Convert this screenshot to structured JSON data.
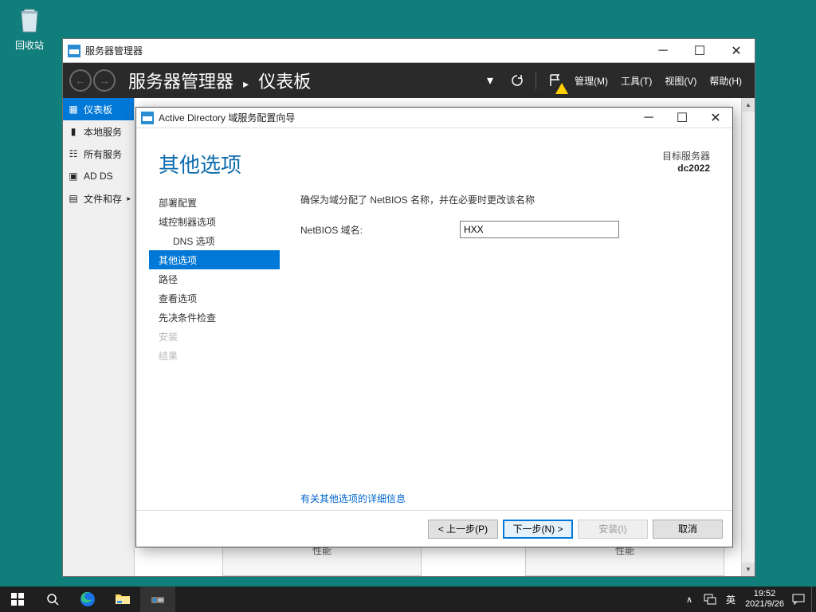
{
  "desktop": {
    "recycle_bin": "回收站"
  },
  "server_manager": {
    "title": "服务器管理器",
    "breadcrumb_root": "服务器管理器",
    "breadcrumb_page": "仪表板",
    "menus": {
      "manage": "管理(M)",
      "tools": "工具(T)",
      "view": "视图(V)",
      "help": "帮助(H)"
    },
    "sidebar": {
      "dashboard": "仪表板",
      "local_server": "本地服务",
      "all_servers": "所有服务",
      "ad_ds": "AD DS",
      "file_storage": "文件和存"
    },
    "tile_perf": "性能"
  },
  "wizard": {
    "window_title": "Active Directory 域服务配置向导",
    "heading": "其他选项",
    "target_label": "目标服务器",
    "target_server": "dc2022",
    "nav": {
      "deployment": "部署配置",
      "dc_options": "域控制器选项",
      "dns_options": "DNS 选项",
      "additional": "其他选项",
      "paths": "路径",
      "review": "查看选项",
      "prereq": "先决条件检查",
      "install": "安装",
      "results": "结果"
    },
    "description": "确保为域分配了 NetBIOS 名称，并在必要时更改该名称",
    "netbios_label": "NetBIOS 域名:",
    "netbios_value": "HXX",
    "more_link": "有关其他选项的详细信息",
    "buttons": {
      "prev": "< 上一步(P)",
      "next": "下一步(N) >",
      "install": "安装(I)",
      "cancel": "取消"
    }
  },
  "taskbar": {
    "ime_lang": "英",
    "time": "19:52",
    "date": "2021/9/26"
  }
}
